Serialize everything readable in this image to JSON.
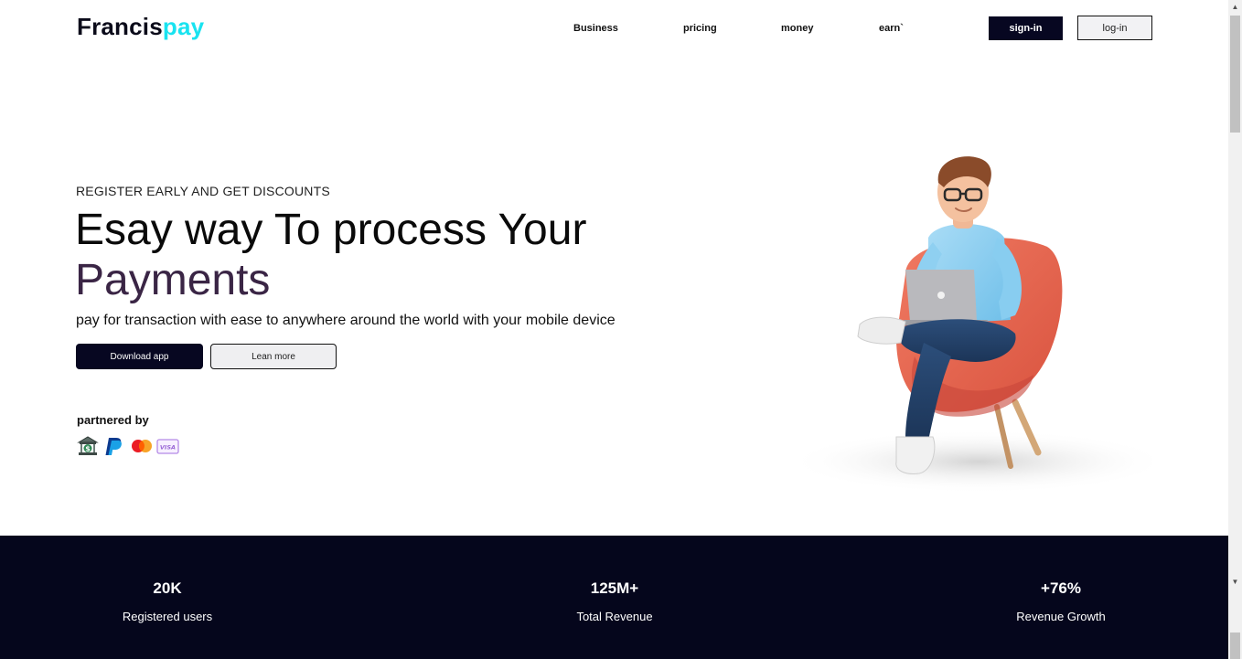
{
  "header": {
    "logo_part1": "Francis",
    "logo_part2": "pay",
    "nav": [
      "Business",
      "pricing",
      "money",
      "earn`"
    ],
    "signin_label": "sign-in",
    "login_label": "log-in"
  },
  "hero": {
    "eyebrow": "REGISTER EARLY AND GET DISCOUNTS",
    "headline_line1": "Esay way To process Your",
    "headline_line2": "Payments",
    "subtitle": "pay for transaction with ease to anywhere around the world with your mobile device",
    "download_label": "Download app",
    "learn_label": "Lean more",
    "partnered_label": "partnered by",
    "partner_icons": [
      "bank-icon",
      "paypal-icon",
      "mastercard-icon",
      "visa-icon"
    ],
    "illustration": "person-sitting-in-chair-with-laptop-illustration"
  },
  "stats": [
    {
      "value": "20K",
      "label": "Registered users"
    },
    {
      "value": "125M+",
      "label": "Total Revenue"
    },
    {
      "value": "+76%",
      "label": "Revenue Growth"
    }
  ],
  "colors": {
    "brand_dark": "#070721",
    "brand_accent": "#19e3f0",
    "headline_accent": "#3a2545",
    "stats_bg": "#05061c"
  }
}
